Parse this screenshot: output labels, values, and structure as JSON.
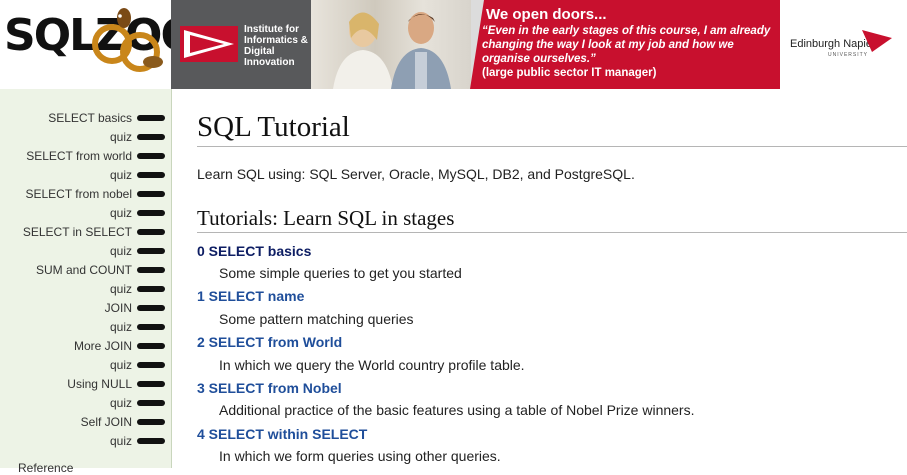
{
  "logo": {
    "text": "SQLZOO"
  },
  "banner": {
    "institute": "Institute for Informatics & Digital Innovation",
    "headline": "We open doors...",
    "quote": "“Even in the early stages of this course, I am already changing the way I look at my job and how we organise ourselves.”",
    "source": "(large public sector IT manager)",
    "university": "Edinburgh Napier",
    "university_sub": "UNIVERSITY"
  },
  "sidebar": {
    "items": [
      {
        "label": "SELECT basics"
      },
      {
        "label": "quiz"
      },
      {
        "label": "SELECT from world"
      },
      {
        "label": "quiz"
      },
      {
        "label": "SELECT from nobel"
      },
      {
        "label": "quiz"
      },
      {
        "label": "SELECT in SELECT"
      },
      {
        "label": "quiz"
      },
      {
        "label": "SUM and COUNT"
      },
      {
        "label": "quiz"
      },
      {
        "label": "JOIN"
      },
      {
        "label": "quiz"
      },
      {
        "label": "More JOIN"
      },
      {
        "label": "quiz"
      },
      {
        "label": "Using NULL"
      },
      {
        "label": "quiz"
      },
      {
        "label": "Self JOIN"
      },
      {
        "label": "quiz"
      }
    ],
    "reference": "Reference"
  },
  "main": {
    "title": "SQL Tutorial",
    "intro": "Learn SQL using: SQL Server, Oracle, MySQL, DB2, and PostgreSQL.",
    "section_title": "Tutorials: Learn SQL in stages",
    "tutorials": [
      {
        "link": "0 SELECT basics",
        "desc": "Some simple queries to get you started"
      },
      {
        "link": "1 SELECT name",
        "desc": "Some pattern matching queries"
      },
      {
        "link": "2 SELECT from World",
        "desc": "In which we query the World country profile table."
      },
      {
        "link": "3 SELECT from Nobel",
        "desc": "Additional practice of the basic features using a table of Nobel Prize winners."
      },
      {
        "link": "4 SELECT within SELECT",
        "desc": "In which we form queries using other queries."
      }
    ]
  },
  "colors": {
    "sidebar_bg": "#edf3e6",
    "link": "#1f4e9a",
    "link_visited": "#0d1d63",
    "banner_red": "#c8102e"
  }
}
